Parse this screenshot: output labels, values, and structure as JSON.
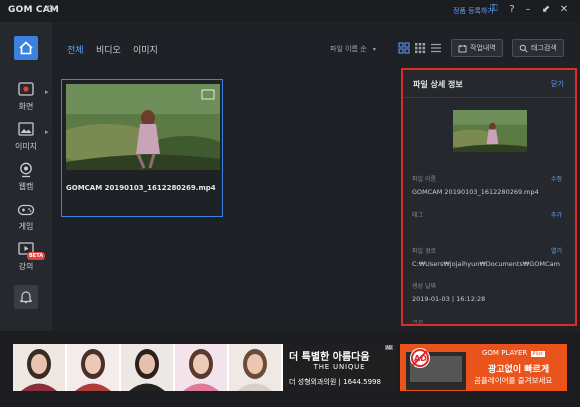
{
  "titlebar": {
    "app_title": "GOM CAM",
    "register_link": "정품 등록하기",
    "help": "?",
    "minimize": "–",
    "restore": "⬋",
    "close": "✕"
  },
  "sidebar": {
    "items": [
      {
        "label": "화면",
        "icon": "screen-record-icon"
      },
      {
        "label": "이미지",
        "icon": "image-icon"
      },
      {
        "label": "웹캠",
        "icon": "webcam-icon"
      },
      {
        "label": "게임",
        "icon": "gamepad-icon"
      },
      {
        "label": "강의",
        "icon": "lecture-icon"
      }
    ],
    "beta_badge": "BETA"
  },
  "toolbar": {
    "tabs": [
      "전체",
      "비디오",
      "이미지"
    ],
    "active_tab": "전체",
    "sort_label": "파일 이름 순",
    "work_history_label": "작업내역",
    "tag_search_label": "태그검색"
  },
  "file": {
    "name": "GOMCAM 20190103_1612280269.mp4"
  },
  "detail": {
    "title": "파일 상세 정보",
    "close_label": "닫기",
    "filename_label": "파일 이름",
    "filename_action": "수정",
    "filename_value": "GOMCAM 20190103_1612280269.mp4",
    "tag_label": "태그",
    "tag_action": "추가",
    "path_label": "파일 경로",
    "path_action": "열기",
    "path_value": "C:₩Users₩jojaihyun₩Documents₩GOMCam",
    "date_label": "생성 날짜",
    "date_value": "2019-01-03 | 16:12:28",
    "size_label": "크기"
  },
  "ads": {
    "ad1_title": "더 특별한 아름다움",
    "ad1_sub": "THE UNIQUE",
    "ad1_contact": "더 성형외과의원 | 1644.5998",
    "ad2_brand": "GOM PLAYER",
    "ad2_brand_tag": "Plus",
    "ad2_line1": "광고없이 빠르게",
    "ad2_line2": "곰플레이어를 즐겨보세요",
    "ad_mark": "AD"
  },
  "colors": {
    "accent": "#3b82e0",
    "link": "#5fa3ff",
    "highlight_border": "#e02a2a",
    "ad2_bg": "#e8541c"
  }
}
